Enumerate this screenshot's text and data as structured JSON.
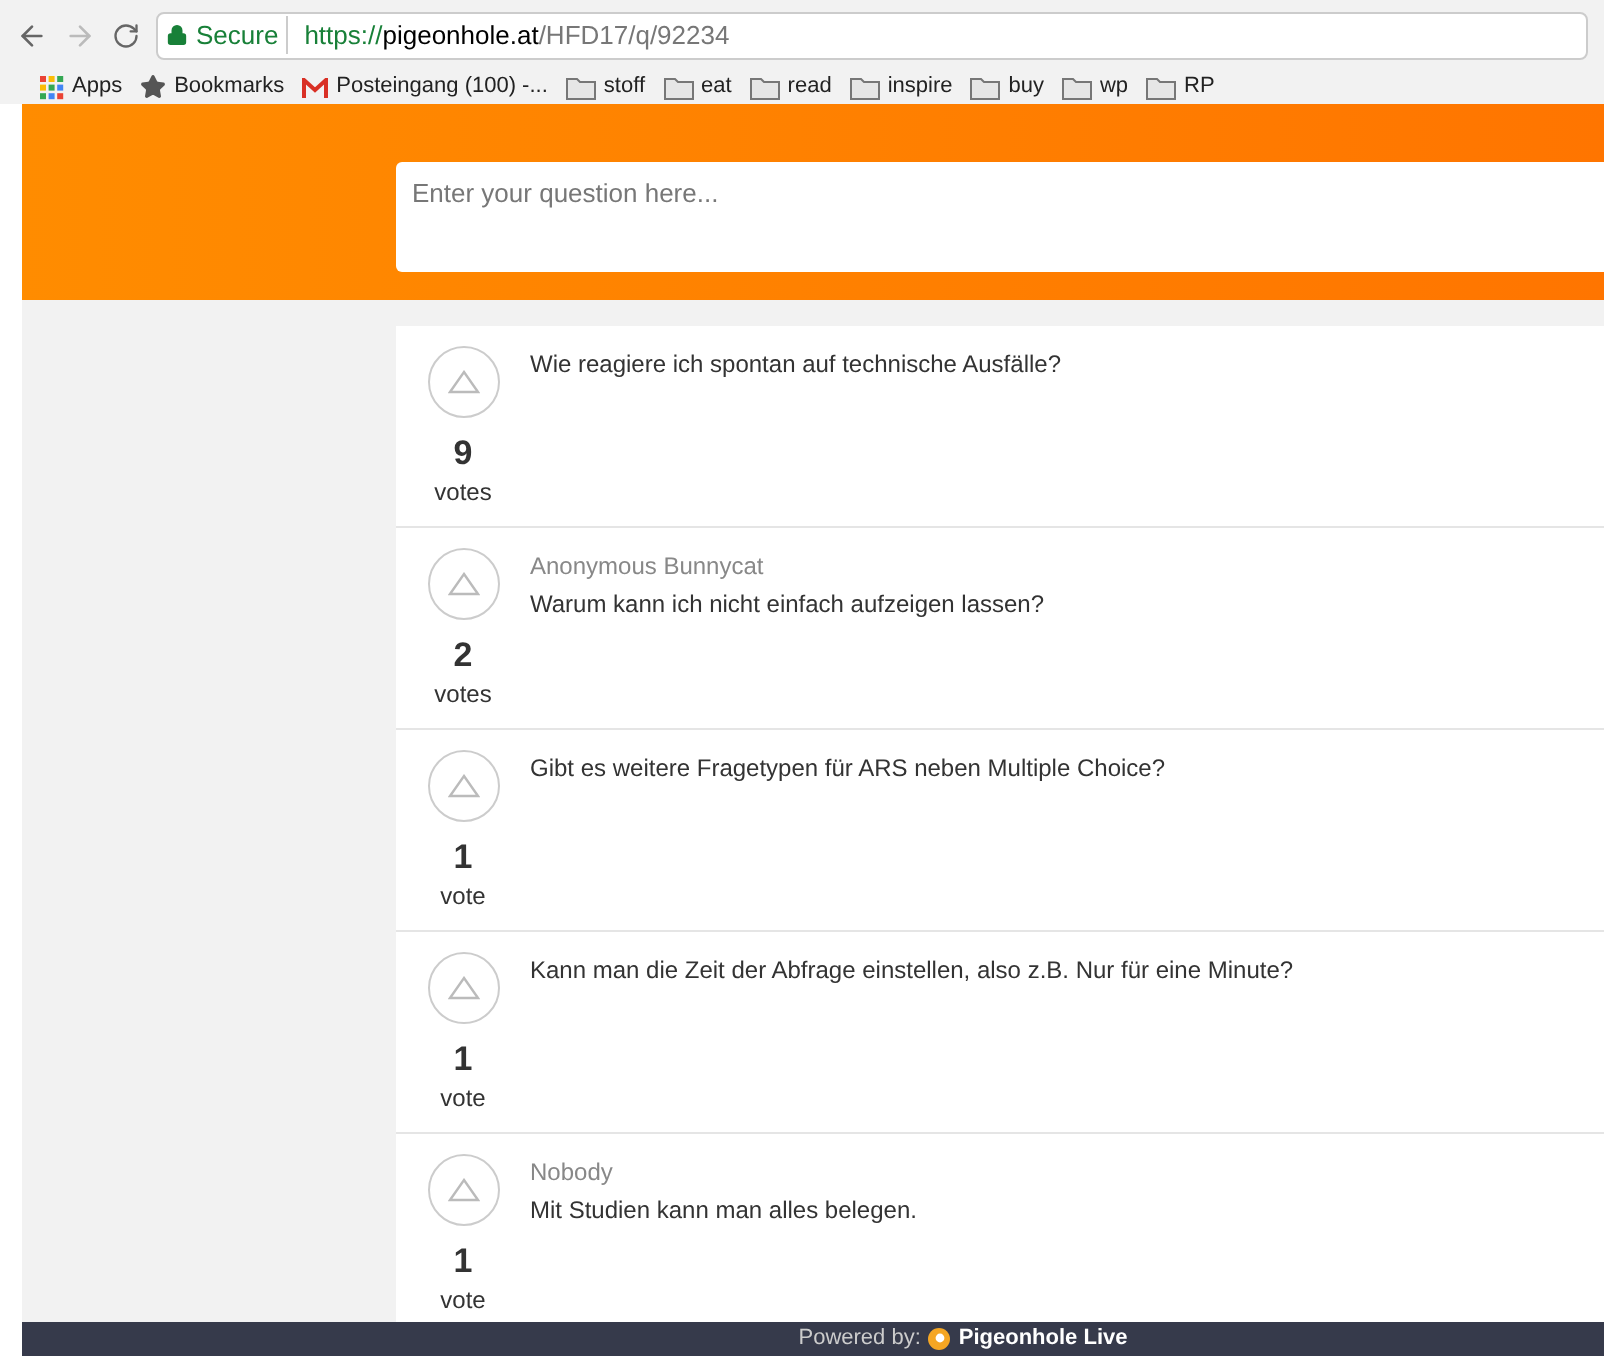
{
  "browser": {
    "secure_label": "Secure",
    "url_scheme": "https://",
    "url_host": "pigeonhole.at",
    "url_path": "/HFD17/q/92234"
  },
  "bookmarks": [
    {
      "label": "Apps",
      "kind": "apps"
    },
    {
      "label": "Bookmarks",
      "kind": "star"
    },
    {
      "label": "Posteingang (100) -...",
      "kind": "mail"
    },
    {
      "label": "stoff",
      "kind": "folder"
    },
    {
      "label": "eat",
      "kind": "folder"
    },
    {
      "label": "read",
      "kind": "folder"
    },
    {
      "label": "inspire",
      "kind": "folder"
    },
    {
      "label": "buy",
      "kind": "folder"
    },
    {
      "label": "wp",
      "kind": "folder"
    },
    {
      "label": "RP",
      "kind": "folder"
    }
  ],
  "question_input": {
    "placeholder": "Enter your question here..."
  },
  "questions": [
    {
      "count": "9",
      "unit": "votes",
      "text": "Wie reagiere ich spontan auf technische Ausfälle?"
    },
    {
      "author": "Anonymous Bunnycat",
      "count": "2",
      "unit": "votes",
      "text": "Warum kann ich nicht einfach aufzeigen lassen?"
    },
    {
      "count": "1",
      "unit": "vote",
      "text": "Gibt es weitere Fragetypen für ARS neben Multiple Choice?"
    },
    {
      "count": "1",
      "unit": "vote",
      "text": "Kann man die Zeit der Abfrage einstellen, also z.B. Nur für eine Minute?"
    },
    {
      "author": "Nobody",
      "count": "1",
      "unit": "vote",
      "text": "Mit Studien kann man alles belegen."
    }
  ],
  "footer": {
    "label": "Powered by:",
    "brand": "Pigeonhole Live"
  }
}
